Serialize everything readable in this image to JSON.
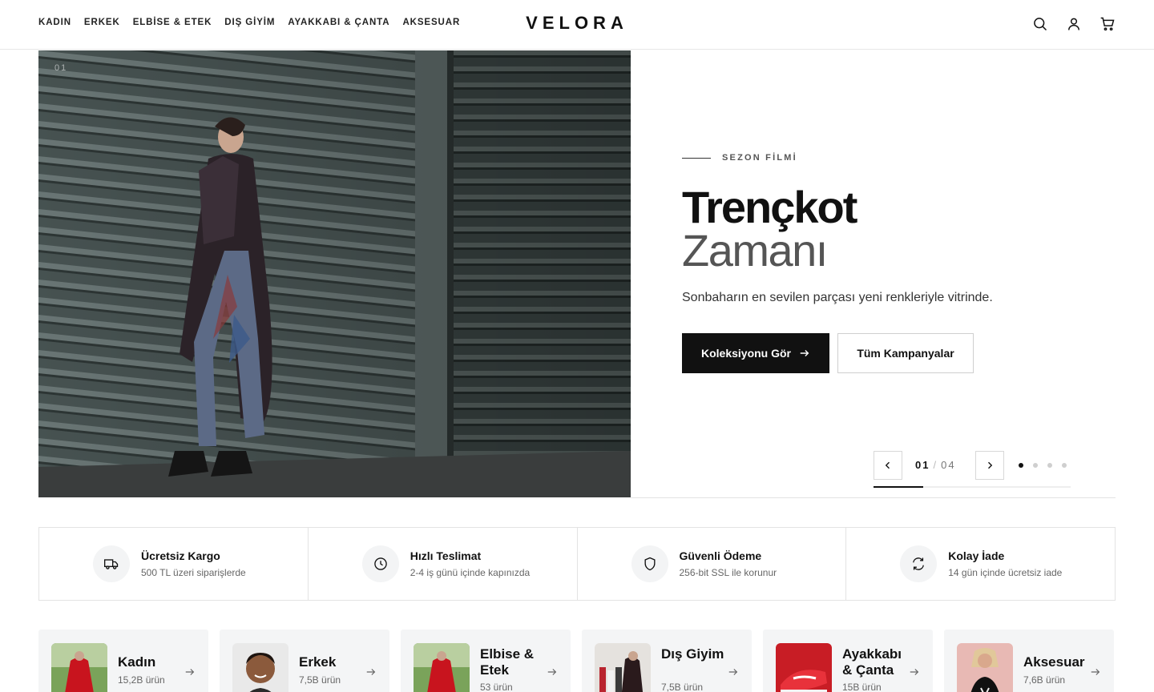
{
  "brand": "VELORA",
  "nav": [
    "KADIN",
    "ERKEK",
    "ELBİSE & ETEK",
    "DIŞ GİYİM",
    "AYAKKABI & ÇANTA",
    "AKSESUAR"
  ],
  "header_icons": [
    "search-icon",
    "user-icon",
    "cart-icon"
  ],
  "hero": {
    "slide_label": "01",
    "eyebrow": "SEZON FİLMİ",
    "title": "Trençkot",
    "subtitle": "Zamanı",
    "description": "Sonbaharın en sevilen parçası yeni renkleriyle vitrinde.",
    "primary_button": "Koleksiyonu Gör",
    "secondary_button": "Tüm Kampanyalar",
    "current_slide": "01",
    "separator": "/",
    "total_slides": "04",
    "slide_progress": 0.25
  },
  "features": [
    {
      "title": "Ücretsiz Kargo",
      "desc": "500 TL üzeri siparişlerde",
      "icon": "truck-icon"
    },
    {
      "title": "Hızlı Teslimat",
      "desc": "2-4 iş günü içinde kapınızda",
      "icon": "clock-icon"
    },
    {
      "title": "Güvenli Ödeme",
      "desc": "256-bit SSL ile korunur",
      "icon": "shield-icon"
    },
    {
      "title": "Kolay İade",
      "desc": "14 gün içinde ücretsiz iade",
      "icon": "refresh-icon"
    }
  ],
  "categories": [
    {
      "name": "Kadın",
      "count": "15,2B ürün"
    },
    {
      "name": "Erkek",
      "count": "7,5B ürün"
    },
    {
      "name": "Elbise & Etek",
      "count": "53 ürün"
    },
    {
      "name": "Dış Giyim",
      "count": "7,5B ürün"
    },
    {
      "name": "Ayakkabı & Çanta",
      "count": "15B ürün"
    },
    {
      "name": "Aksesuar",
      "count": "7,6B ürün"
    }
  ],
  "colors": {
    "primary": "#111111",
    "muted": "#666666",
    "surface": "#f4f5f6"
  }
}
